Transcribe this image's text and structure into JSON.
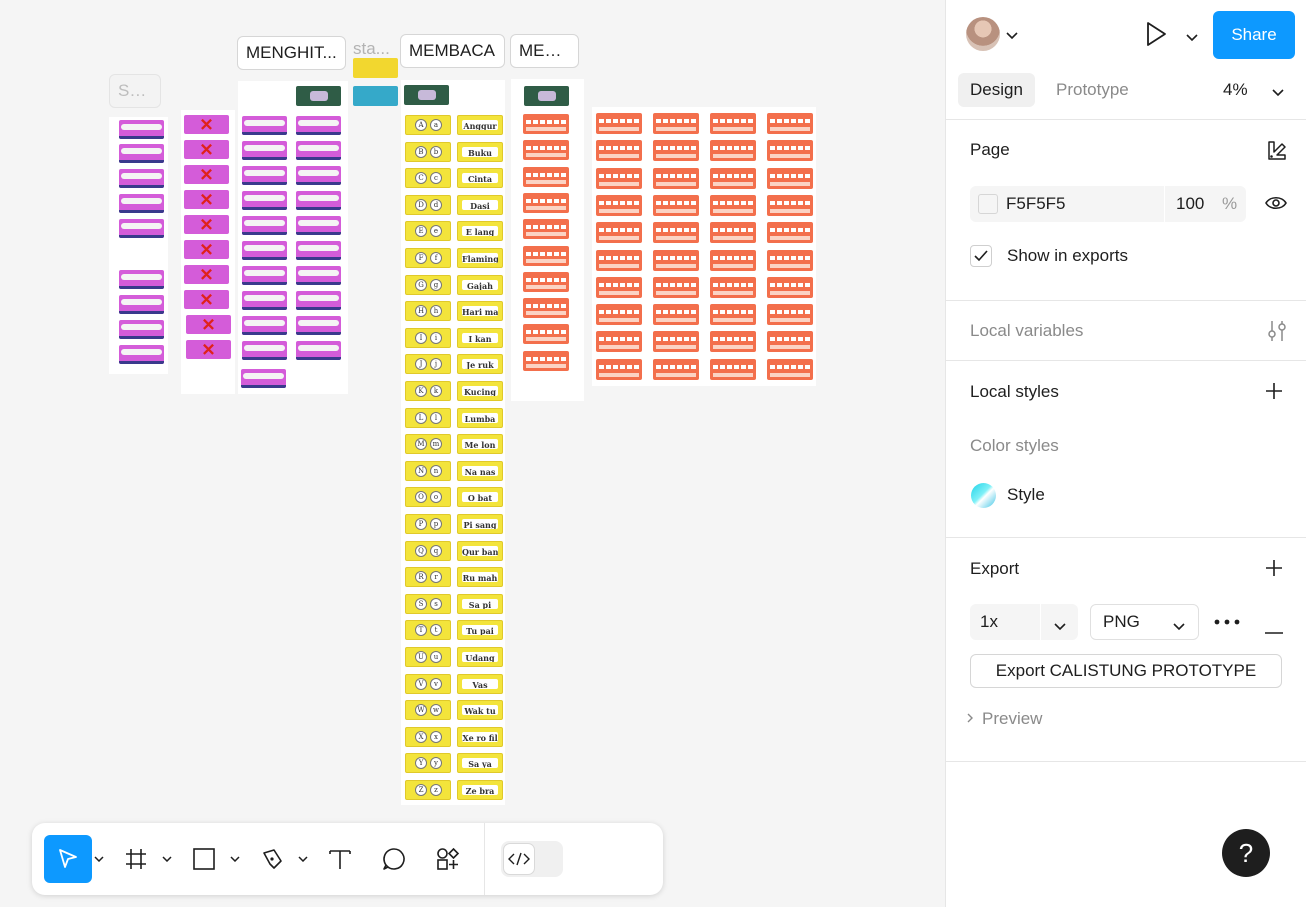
{
  "canvas": {
    "sections": {
      "first": "Se...",
      "menghitung": "MENGHIT...",
      "start": "sta...",
      "membaca": "MEMBACA",
      "menulis": "MEN..."
    },
    "membaca_words": [
      "Anggur",
      "Buku",
      "Cinta",
      "Dasi",
      "E lang",
      "Flamingo",
      "Gajah",
      "Hari mau",
      "I kan",
      "Je ruk",
      "Kucing",
      "Lumba",
      "Me lon",
      "Na nas",
      "O bat",
      "Pi sang",
      "Qur ban",
      "Ru mah",
      "Sa pi",
      "Tu pai",
      "Udang",
      "Vas",
      "Wak tu",
      "Xe ro fil",
      "Sa ya",
      "Ze bra"
    ],
    "membaca_letters": [
      "A a",
      "B b",
      "C c",
      "D d",
      "E e",
      "F f",
      "G g",
      "H h",
      "I i",
      "J j",
      "K k",
      "L l",
      "M m",
      "N n",
      "O o",
      "P p",
      "Q q",
      "R r",
      "S s",
      "T t",
      "U u",
      "V v",
      "W w",
      "X x",
      "Y y",
      "Z z"
    ],
    "colors": {
      "pink_slide": "#d45cd9",
      "yellow_slide": "#f3e43b",
      "orange_slide": "#f36f4c",
      "canvas_bg": "#f5f5f5"
    }
  },
  "toolbar": {
    "tools": [
      "move-tool",
      "frame-tool",
      "shape-tool",
      "pen-tool",
      "text-tool",
      "comment-tool",
      "actions-tool",
      "dev-mode-toggle"
    ]
  },
  "panel": {
    "share_label": "Share",
    "tabs": {
      "design": "Design",
      "prototype": "Prototype"
    },
    "zoom": "4%",
    "page": {
      "title": "Page",
      "fill_hex": "F5F5F5",
      "opacity": "100",
      "opacity_unit": "%",
      "show_in_exports": "Show in exports"
    },
    "local_variables": "Local variables",
    "local_styles": {
      "title": "Local styles",
      "color_styles": "Color styles",
      "style_name": "Style"
    },
    "export": {
      "title": "Export",
      "scale": "1x",
      "format": "PNG",
      "button": "Export CALISTUNG PROTOTYPE",
      "preview": "Preview"
    },
    "help": "?",
    "accent": "#0d99ff"
  }
}
